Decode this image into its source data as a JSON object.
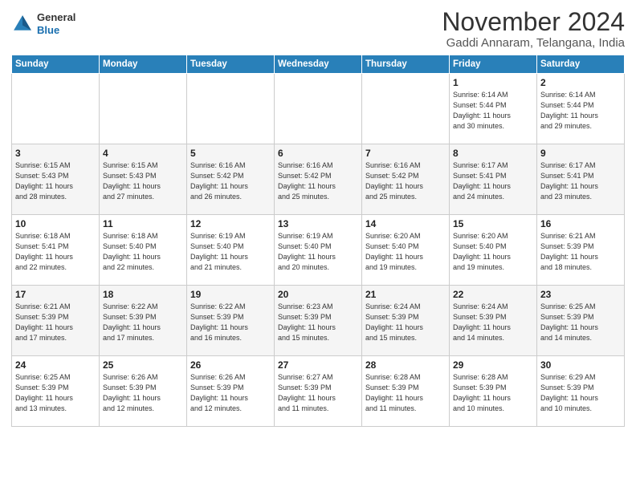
{
  "header": {
    "logo_line1": "General",
    "logo_line2": "Blue",
    "month": "November 2024",
    "location": "Gaddi Annaram, Telangana, India"
  },
  "days_of_week": [
    "Sunday",
    "Monday",
    "Tuesday",
    "Wednesday",
    "Thursday",
    "Friday",
    "Saturday"
  ],
  "weeks": [
    [
      {
        "day": "",
        "info": ""
      },
      {
        "day": "",
        "info": ""
      },
      {
        "day": "",
        "info": ""
      },
      {
        "day": "",
        "info": ""
      },
      {
        "day": "",
        "info": ""
      },
      {
        "day": "1",
        "info": "Sunrise: 6:14 AM\nSunset: 5:44 PM\nDaylight: 11 hours\nand 30 minutes."
      },
      {
        "day": "2",
        "info": "Sunrise: 6:14 AM\nSunset: 5:44 PM\nDaylight: 11 hours\nand 29 minutes."
      }
    ],
    [
      {
        "day": "3",
        "info": "Sunrise: 6:15 AM\nSunset: 5:43 PM\nDaylight: 11 hours\nand 28 minutes."
      },
      {
        "day": "4",
        "info": "Sunrise: 6:15 AM\nSunset: 5:43 PM\nDaylight: 11 hours\nand 27 minutes."
      },
      {
        "day": "5",
        "info": "Sunrise: 6:16 AM\nSunset: 5:42 PM\nDaylight: 11 hours\nand 26 minutes."
      },
      {
        "day": "6",
        "info": "Sunrise: 6:16 AM\nSunset: 5:42 PM\nDaylight: 11 hours\nand 25 minutes."
      },
      {
        "day": "7",
        "info": "Sunrise: 6:16 AM\nSunset: 5:42 PM\nDaylight: 11 hours\nand 25 minutes."
      },
      {
        "day": "8",
        "info": "Sunrise: 6:17 AM\nSunset: 5:41 PM\nDaylight: 11 hours\nand 24 minutes."
      },
      {
        "day": "9",
        "info": "Sunrise: 6:17 AM\nSunset: 5:41 PM\nDaylight: 11 hours\nand 23 minutes."
      }
    ],
    [
      {
        "day": "10",
        "info": "Sunrise: 6:18 AM\nSunset: 5:41 PM\nDaylight: 11 hours\nand 22 minutes."
      },
      {
        "day": "11",
        "info": "Sunrise: 6:18 AM\nSunset: 5:40 PM\nDaylight: 11 hours\nand 22 minutes."
      },
      {
        "day": "12",
        "info": "Sunrise: 6:19 AM\nSunset: 5:40 PM\nDaylight: 11 hours\nand 21 minutes."
      },
      {
        "day": "13",
        "info": "Sunrise: 6:19 AM\nSunset: 5:40 PM\nDaylight: 11 hours\nand 20 minutes."
      },
      {
        "day": "14",
        "info": "Sunrise: 6:20 AM\nSunset: 5:40 PM\nDaylight: 11 hours\nand 19 minutes."
      },
      {
        "day": "15",
        "info": "Sunrise: 6:20 AM\nSunset: 5:40 PM\nDaylight: 11 hours\nand 19 minutes."
      },
      {
        "day": "16",
        "info": "Sunrise: 6:21 AM\nSunset: 5:39 PM\nDaylight: 11 hours\nand 18 minutes."
      }
    ],
    [
      {
        "day": "17",
        "info": "Sunrise: 6:21 AM\nSunset: 5:39 PM\nDaylight: 11 hours\nand 17 minutes."
      },
      {
        "day": "18",
        "info": "Sunrise: 6:22 AM\nSunset: 5:39 PM\nDaylight: 11 hours\nand 17 minutes."
      },
      {
        "day": "19",
        "info": "Sunrise: 6:22 AM\nSunset: 5:39 PM\nDaylight: 11 hours\nand 16 minutes."
      },
      {
        "day": "20",
        "info": "Sunrise: 6:23 AM\nSunset: 5:39 PM\nDaylight: 11 hours\nand 15 minutes."
      },
      {
        "day": "21",
        "info": "Sunrise: 6:24 AM\nSunset: 5:39 PM\nDaylight: 11 hours\nand 15 minutes."
      },
      {
        "day": "22",
        "info": "Sunrise: 6:24 AM\nSunset: 5:39 PM\nDaylight: 11 hours\nand 14 minutes."
      },
      {
        "day": "23",
        "info": "Sunrise: 6:25 AM\nSunset: 5:39 PM\nDaylight: 11 hours\nand 14 minutes."
      }
    ],
    [
      {
        "day": "24",
        "info": "Sunrise: 6:25 AM\nSunset: 5:39 PM\nDaylight: 11 hours\nand 13 minutes."
      },
      {
        "day": "25",
        "info": "Sunrise: 6:26 AM\nSunset: 5:39 PM\nDaylight: 11 hours\nand 12 minutes."
      },
      {
        "day": "26",
        "info": "Sunrise: 6:26 AM\nSunset: 5:39 PM\nDaylight: 11 hours\nand 12 minutes."
      },
      {
        "day": "27",
        "info": "Sunrise: 6:27 AM\nSunset: 5:39 PM\nDaylight: 11 hours\nand 11 minutes."
      },
      {
        "day": "28",
        "info": "Sunrise: 6:28 AM\nSunset: 5:39 PM\nDaylight: 11 hours\nand 11 minutes."
      },
      {
        "day": "29",
        "info": "Sunrise: 6:28 AM\nSunset: 5:39 PM\nDaylight: 11 hours\nand 10 minutes."
      },
      {
        "day": "30",
        "info": "Sunrise: 6:29 AM\nSunset: 5:39 PM\nDaylight: 11 hours\nand 10 minutes."
      }
    ]
  ]
}
